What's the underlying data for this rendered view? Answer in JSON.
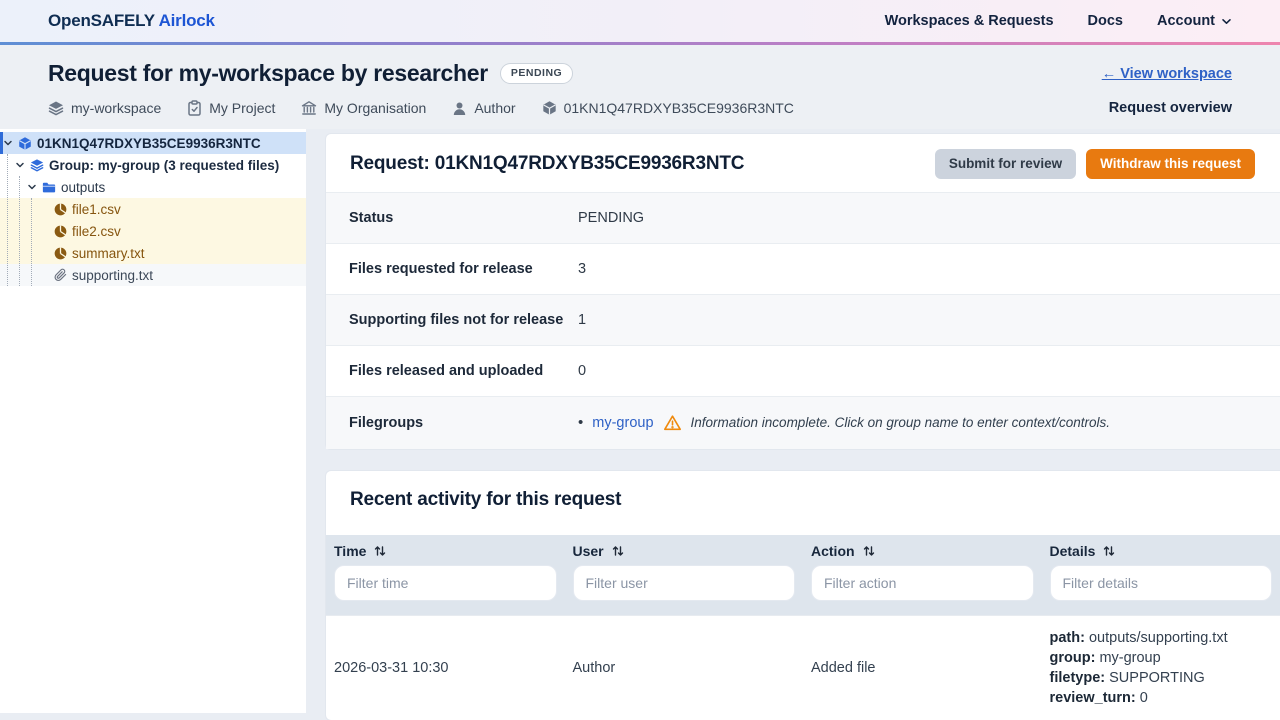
{
  "navbar": {
    "logo_primary": "OpenSAFELY",
    "logo_secondary": "Airlock",
    "links": [
      {
        "label": "Workspaces & Requests"
      },
      {
        "label": "Docs"
      },
      {
        "label": "Account"
      }
    ]
  },
  "header": {
    "title": "Request for my-workspace by researcher",
    "status_badge": "PENDING",
    "view_workspace_link": "← View workspace",
    "overview_label": "Request overview",
    "meta": [
      {
        "icon": "layers-icon",
        "label": "my-workspace"
      },
      {
        "icon": "clipboard-icon",
        "label": "My Project"
      },
      {
        "icon": "bank-icon",
        "label": "My Organisation"
      },
      {
        "icon": "user-icon",
        "label": "Author"
      },
      {
        "icon": "package-icon",
        "label": "01KN1Q47RDXYB35CE9936R3NTC"
      }
    ]
  },
  "tree": {
    "request_id": "01KN1Q47RDXYB35CE9936R3NTC",
    "group_label": "Group: my-group (3 requested files)",
    "folder_label": "outputs",
    "output_files": [
      "file1.csv",
      "file2.csv",
      "summary.txt"
    ],
    "supporting_files": [
      "supporting.txt"
    ]
  },
  "request_panel": {
    "title": "Request: 01KN1Q47RDXYB35CE9936R3NTC",
    "submit_button": "Submit for review",
    "withdraw_button": "Withdraw this request",
    "rows": [
      {
        "label": "Status",
        "value": "PENDING"
      },
      {
        "label": "Files requested for release",
        "value": "3"
      },
      {
        "label": "Supporting files not for release",
        "value": "1"
      },
      {
        "label": "Files released and uploaded",
        "value": "0"
      }
    ],
    "filegroups": {
      "label": "Filegroups",
      "bullet": "•",
      "group_link": "my-group",
      "warning_text": "Information incomplete. Click on group name to enter context/controls."
    }
  },
  "activity": {
    "title": "Recent activity for this request",
    "columns": [
      {
        "label": "Time",
        "filter_placeholder": "Filter time"
      },
      {
        "label": "User",
        "filter_placeholder": "Filter user"
      },
      {
        "label": "Action",
        "filter_placeholder": "Filter action"
      },
      {
        "label": "Details",
        "filter_placeholder": "Filter details"
      }
    ],
    "rows": [
      {
        "time": "2026-03-31 10:30",
        "user": "Author",
        "action": "Added file",
        "details": [
          {
            "key": "path:",
            "value": "outputs/supporting.txt"
          },
          {
            "key": "group:",
            "value": "my-group"
          },
          {
            "key": "filetype:",
            "value": "SUPPORTING"
          },
          {
            "key": "review_turn:",
            "value": "0"
          }
        ]
      }
    ]
  },
  "colors": {
    "brand_navy": "#0f2d52",
    "brand_blue": "#1d55d4",
    "link_blue": "#2e61c6",
    "withdraw_orange": "#e87a10",
    "warning_orange": "#ef8a0e",
    "selected_row_blue": "#cfe1f8",
    "output_file_cream": "#fdf8e2",
    "output_file_brown": "#86550f"
  }
}
